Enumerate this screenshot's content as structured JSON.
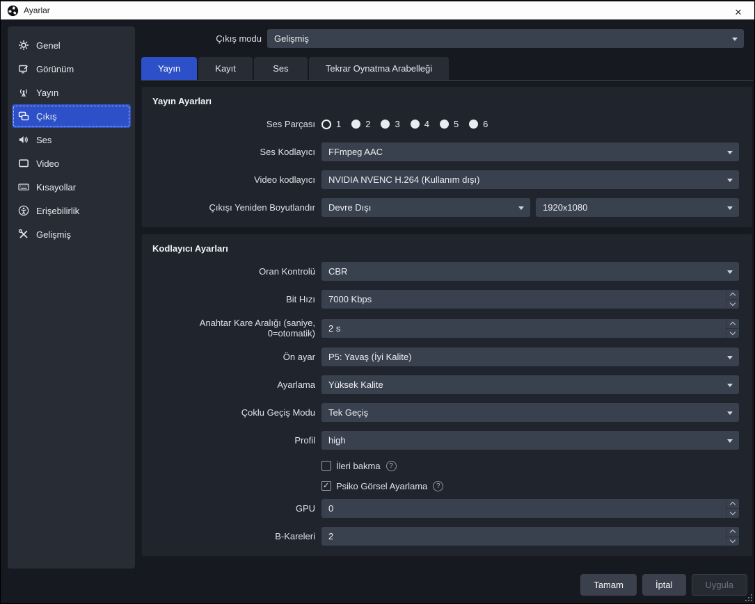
{
  "window": {
    "title": "Ayarlar",
    "close_glyph": "×"
  },
  "sidebar": {
    "items": [
      {
        "label": "Genel",
        "icon": "gear"
      },
      {
        "label": "Görünüm",
        "icon": "display-edit"
      },
      {
        "label": "Yayın",
        "icon": "broadcast-antenna"
      },
      {
        "label": "Çıkış",
        "icon": "output-screens",
        "selected": true
      },
      {
        "label": "Ses",
        "icon": "speaker"
      },
      {
        "label": "Video",
        "icon": "monitor"
      },
      {
        "label": "Kısayollar",
        "icon": "keyboard"
      },
      {
        "label": "Erişebilirlik",
        "icon": "accessibility"
      },
      {
        "label": "Gelişmiş",
        "icon": "tools"
      }
    ]
  },
  "output_mode": {
    "label": "Çıkış modu",
    "value": "Gelişmiş"
  },
  "tabs": [
    {
      "label": "Yayın",
      "active": true
    },
    {
      "label": "Kayıt",
      "active": false
    },
    {
      "label": "Ses",
      "active": false
    },
    {
      "label": "Tekrar Oynatma Arabelleği",
      "active": false
    }
  ],
  "stream": {
    "title": "Yayın Ayarları",
    "audio_track": {
      "label": "Ses Parçası",
      "options": [
        "1",
        "2",
        "3",
        "4",
        "5",
        "6"
      ],
      "selected": "1"
    },
    "audio_encoder": {
      "label": "Ses Kodlayıcı",
      "value": "FFmpeg AAC"
    },
    "video_encoder": {
      "label": "Video kodlayıcı",
      "value": "NVIDIA NVENC H.264 (Kullanım dışı)"
    },
    "rescale": {
      "label": "Çıkışı Yeniden Boyutlandır",
      "value": "Devre Dışı",
      "resolution": "1920x1080"
    }
  },
  "encoder": {
    "title": "Kodlayıcı Ayarları",
    "rate_control": {
      "label": "Oran Kontrolü",
      "value": "CBR"
    },
    "bitrate": {
      "label": "Bit Hızı",
      "value": "7000 Kbps"
    },
    "keyframe_interval": {
      "label": "Anahtar Kare Aralığı (saniye, 0=otomatik)",
      "value": "2 s"
    },
    "preset": {
      "label": "Ön ayar",
      "value": "P5: Yavaş (İyi Kalite)"
    },
    "tuning": {
      "label": "Ayarlama",
      "value": "Yüksek Kalite"
    },
    "multipass": {
      "label": "Çoklu Geçiş Modu",
      "value": "Tek Geçiş"
    },
    "profile": {
      "label": "Profil",
      "value": "high"
    },
    "lookahead": {
      "label": "İleri bakma",
      "checked": false,
      "help": "?"
    },
    "psycho_visual": {
      "label": "Psiko Görsel Ayarlama",
      "checked": true,
      "help": "?"
    },
    "gpu": {
      "label": "GPU",
      "value": "0"
    },
    "bframes": {
      "label": "B-Kareleri",
      "value": "2"
    }
  },
  "footer": {
    "ok": "Tamam",
    "cancel": "İptal",
    "apply": "Uygula"
  },
  "colors": {
    "accent": "#2d50c8",
    "background": "#16191f",
    "sidebar": "#272c35",
    "panel": "#20252d",
    "field": "#3a414e",
    "titlebar": "#fdfdfd"
  }
}
